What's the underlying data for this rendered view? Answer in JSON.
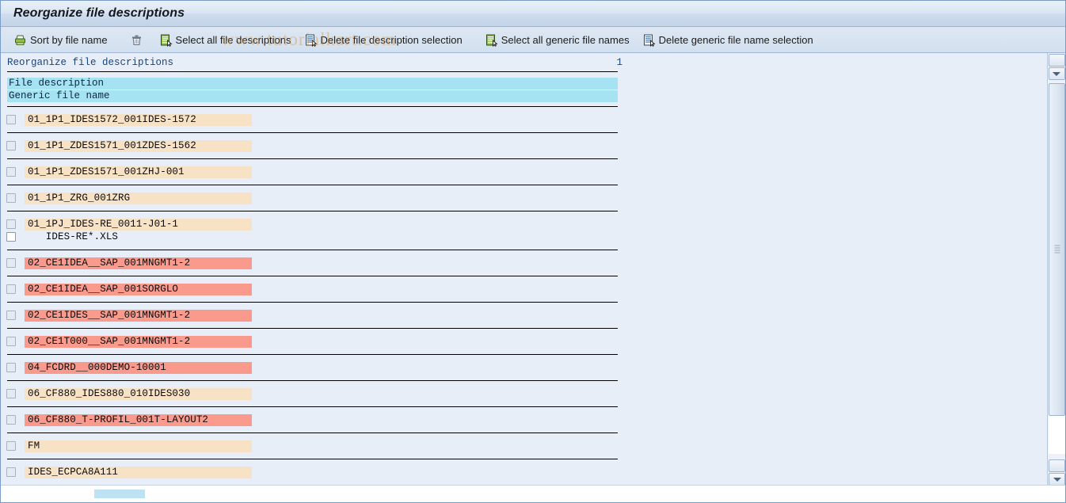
{
  "window": {
    "title": "Reorganize file descriptions"
  },
  "toolbar": {
    "items": [
      {
        "label": "Sort by file name",
        "icon": "sort-printer-icon"
      },
      {
        "label": "",
        "icon": "trash-icon"
      },
      {
        "label": "Select all file descriptions",
        "icon": "select-all-descriptions-icon"
      },
      {
        "label": "Delete file description selection",
        "icon": "delete-description-selection-icon"
      },
      {
        "label": "Select all generic file names",
        "icon": "select-all-generic-icon"
      },
      {
        "label": "Delete generic file name selection",
        "icon": "delete-generic-selection-icon"
      }
    ]
  },
  "report": {
    "header_title": "Reorganize file descriptions",
    "page_number": "1",
    "column_headers": [
      "File description",
      "Generic file name"
    ],
    "rows": [
      {
        "description": "01_1P1_IDES1572_001IDES-1572",
        "style": "beige",
        "generic": null
      },
      {
        "description": "01_1P1_ZDES1571_001ZDES-1562",
        "style": "beige",
        "generic": null
      },
      {
        "description": "01_1P1_ZDES1571_001ZHJ-001",
        "style": "beige",
        "generic": null
      },
      {
        "description": "01_1P1_ZRG_001ZRG",
        "style": "beige",
        "generic": null
      },
      {
        "description": "01_1PJ_IDES-RE_0011-J01-1",
        "style": "beige",
        "generic": "   IDES-RE*.XLS"
      },
      {
        "description": "02_CE1IDEA__SAP_001MNGMT1-2",
        "style": "salmon",
        "generic": null
      },
      {
        "description": "02_CE1IDEA__SAP_001SORGLO",
        "style": "salmon",
        "generic": null
      },
      {
        "description": "02_CE1IDES__SAP_001MNGMT1-2",
        "style": "salmon",
        "generic": null
      },
      {
        "description": "02_CE1T000__SAP_001MNGMT1-2",
        "style": "salmon",
        "generic": null
      },
      {
        "description": "04_FCDRD__000DEMO-10001",
        "style": "salmon",
        "generic": null
      },
      {
        "description": "06_CF880_IDES880_010IDES030",
        "style": "beige",
        "generic": null
      },
      {
        "description": "06_CF880_T-PROFIL_001T-LAYOUT2",
        "style": "salmon",
        "generic": null
      },
      {
        "description": "FM",
        "style": "beige",
        "generic": null
      },
      {
        "description": "IDES_ECPCA8A111",
        "style": "beige",
        "generic": null
      }
    ]
  },
  "watermark": {
    "text": "www.tutorialkart.com"
  },
  "colors": {
    "highlight_beige": "#f7e2c6",
    "highlight_salmon": "#fa9a8c",
    "column_header_cyan": "#a5e3f2",
    "report_header_blue": "#16457e",
    "page_background": "#e8eef7"
  }
}
